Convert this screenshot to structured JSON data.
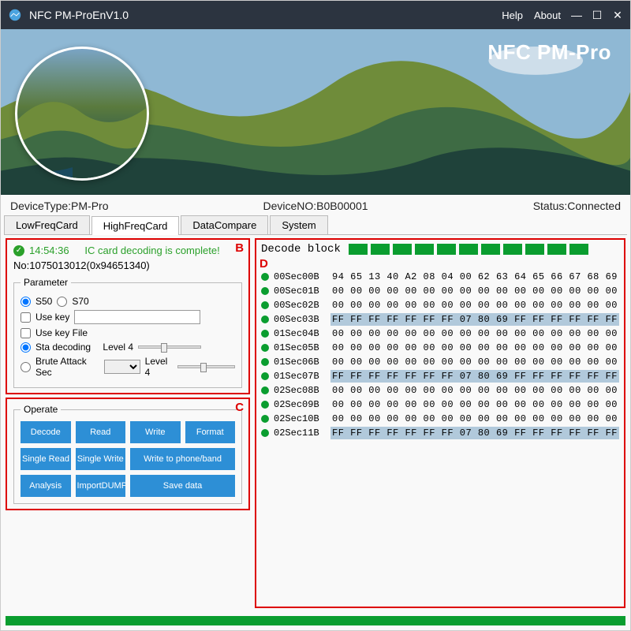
{
  "titlebar": {
    "title": "NFC PM-ProEnV1.0",
    "menu_help": "Help",
    "menu_about": "About"
  },
  "hero": {
    "brand": "NFC PM-Pro"
  },
  "status": {
    "device_type_label": "DeviceType:",
    "device_type_value": "PM-Pro",
    "device_no_label": "DeviceNO:",
    "device_no_value": "B0B00001",
    "status_label": "Status:",
    "status_value": "Connected"
  },
  "tabs": [
    "LowFreqCard",
    "HighFreqCard",
    "DataCompare",
    "System"
  ],
  "panelB": {
    "label": "B",
    "time": "14:54:36",
    "message": "IC card decoding is complete!",
    "no_label": "No:",
    "no_value": "1075013012(0x94651340)",
    "parameter_legend": "Parameter",
    "radio_s50": "S50",
    "radio_s70": "S70",
    "use_key_label": "Use key",
    "use_key_value": "",
    "use_key_file_label": "Use key File",
    "sta_decoding_label": "Sta decoding",
    "level4a": "Level 4",
    "brute_label": "Brute Attack Sec",
    "level4b": "Level 4"
  },
  "panelC": {
    "label": "C",
    "legend": "Operate",
    "buttons": {
      "decode": "Decode",
      "read": "Read",
      "write": "Write",
      "format": "Format",
      "single_read": "Single Read",
      "single_write": "Single Write",
      "write_phone": "Write to phone/band",
      "analysis": "Analysis",
      "import_dump": "ImportDUMP",
      "save_data": "Save data"
    }
  },
  "panelD": {
    "label": "D",
    "title": "Decode block",
    "segments": 11,
    "blocks": [
      {
        "name": "00Sec00B",
        "hex": "94 65 13 40 A2 08 04 00 62 63 64 65 66 67 68 69",
        "hl": false
      },
      {
        "name": "00Sec01B",
        "hex": "00 00 00 00 00 00 00 00 00 00 00 00 00 00 00 00",
        "hl": false
      },
      {
        "name": "00Sec02B",
        "hex": "00 00 00 00 00 00 00 00 00 00 00 00 00 00 00 00",
        "hl": false
      },
      {
        "name": "00Sec03B",
        "hex": "FF FF FF FF FF FF FF 07 80 69 FF FF FF FF FF FF",
        "hl": true
      },
      {
        "name": "01Sec04B",
        "hex": "00 00 00 00 00 00 00 00 00 00 00 00 00 00 00 00",
        "hl": false
      },
      {
        "name": "01Sec05B",
        "hex": "00 00 00 00 00 00 00 00 00 00 00 00 00 00 00 00",
        "hl": false
      },
      {
        "name": "01Sec06B",
        "hex": "00 00 00 00 00 00 00 00 00 00 00 00 00 00 00 00",
        "hl": false
      },
      {
        "name": "01Sec07B",
        "hex": "FF FF FF FF FF FF FF 07 80 69 FF FF FF FF FF FF",
        "hl": true
      },
      {
        "name": "02Sec08B",
        "hex": "00 00 00 00 00 00 00 00 00 00 00 00 00 00 00 00",
        "hl": false
      },
      {
        "name": "02Sec09B",
        "hex": "00 00 00 00 00 00 00 00 00 00 00 00 00 00 00 00",
        "hl": false
      },
      {
        "name": "02Sec10B",
        "hex": "00 00 00 00 00 00 00 00 00 00 00 00 00 00 00 00",
        "hl": false
      },
      {
        "name": "02Sec11B",
        "hex": "FF FF FF FF FF FF FF 07 80 69 FF FF FF FF FF FF",
        "hl": true
      }
    ]
  }
}
